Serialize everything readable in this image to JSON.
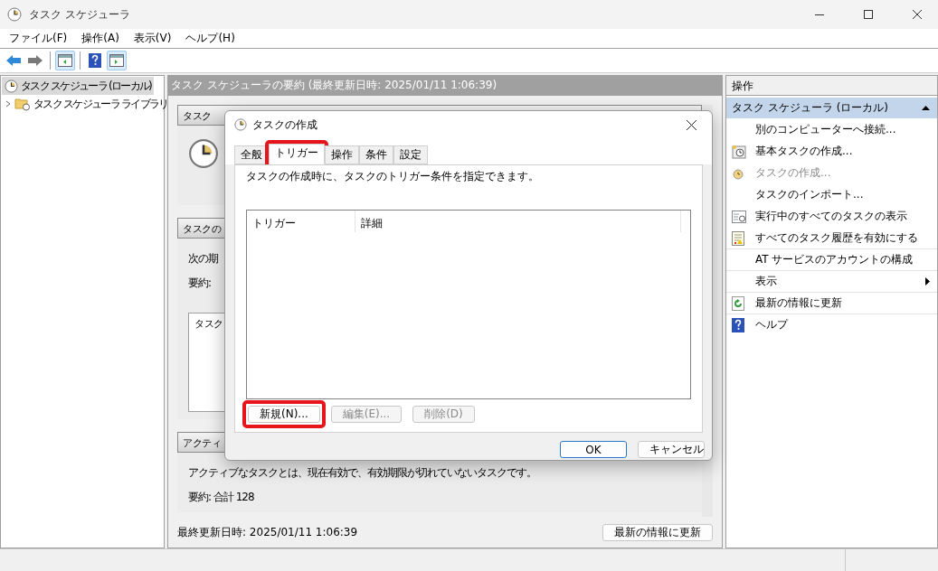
{
  "window": {
    "title": "タスク スケジューラ"
  },
  "menu": [
    "ファイル(F)",
    "操作(A)",
    "表示(V)",
    "ヘルプ(H)"
  ],
  "toolbar": [
    {
      "kind": "back",
      "pressed": false
    },
    {
      "kind": "forward",
      "pressed": false
    },
    {
      "kind": "tree-pane",
      "pressed": true
    },
    {
      "kind": "help",
      "pressed": false
    },
    {
      "kind": "action-pane",
      "pressed": true
    }
  ],
  "tree": [
    {
      "label": "タスク スケジューラ (ローカル)",
      "selected": true,
      "children": [
        {
          "label": "タスク スケジューラ ライブラリ",
          "selected": false,
          "expanded": false
        }
      ]
    }
  ],
  "summary": {
    "header": "タスク スケジューラの要約 (最終更新日時: 2025/01/11 1:06:39)",
    "sections": [
      {
        "kind": "overview",
        "title": "タスク"
      },
      {
        "kind": "status",
        "title": "タスクの",
        "lines": [
          "次の期",
          "要約:"
        ],
        "list_header": "タスク"
      },
      {
        "kind": "active",
        "title": "アクティ",
        "lines": [
          "アクティブなタスクとは、現在有効で、有効期限が切れていないタスクです。",
          "要約: 合計 128"
        ]
      }
    ],
    "last_updated": "最終更新日時: 2025/01/11 1:06:39",
    "refresh_button": "最新の情報に更新"
  },
  "dialog": {
    "title": "タスクの作成",
    "tabs": [
      {
        "label": "全般",
        "selected": false,
        "highlighted": false
      },
      {
        "label": "トリガー",
        "selected": true,
        "highlighted": true
      },
      {
        "label": "操作",
        "selected": false,
        "highlighted": false
      },
      {
        "label": "条件",
        "selected": false,
        "highlighted": false
      },
      {
        "label": "設定",
        "selected": false,
        "highlighted": false
      }
    ],
    "description": "タスクの作成時に、タスクのトリガー条件を指定できます。",
    "columns": [
      "トリガー",
      "詳細"
    ],
    "buttons": [
      {
        "label": "新規(N)...",
        "disabled": false,
        "highlighted": true
      },
      {
        "label": "編集(E)...",
        "disabled": true,
        "highlighted": false
      },
      {
        "label": "削除(D)",
        "disabled": true,
        "highlighted": false
      }
    ],
    "ok": "OK",
    "cancel": "キャンセル"
  },
  "actions": {
    "title": "操作",
    "group": {
      "title": "タスク スケジューラ (ローカル)",
      "expanded": true
    },
    "items": [
      {
        "kind": "plain",
        "label": "別のコンピューターへ接続...",
        "disabled": false
      },
      {
        "kind": "basic-task",
        "label": "基本タスクの作成...",
        "disabled": false
      },
      {
        "kind": "create-task",
        "label": "タスクの作成...",
        "disabled": true
      },
      {
        "kind": "plain",
        "label": "タスクのインポート...",
        "disabled": false
      },
      {
        "kind": "running",
        "label": "実行中のすべてのタスクの表示",
        "disabled": false
      },
      {
        "kind": "history",
        "label": "すべてのタスク履歴を有効にする",
        "disabled": false
      },
      {
        "kind": "plain",
        "label": "AT サービスのアカウントの構成",
        "disabled": false
      },
      {
        "kind": "submenu",
        "label": "表示",
        "disabled": false
      },
      {
        "kind": "refresh",
        "label": "最新の情報に更新",
        "disabled": false
      },
      {
        "kind": "help",
        "label": "ヘルプ",
        "disabled": false
      }
    ]
  }
}
